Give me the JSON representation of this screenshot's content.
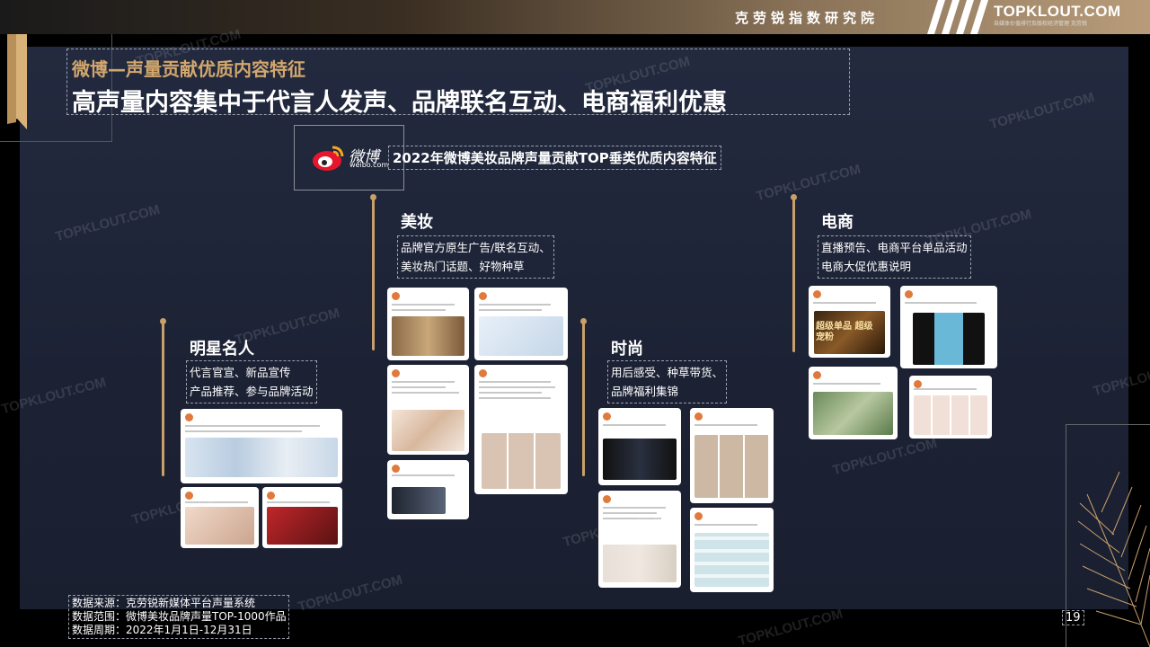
{
  "header": {
    "org_name": "克劳锐指数研究院",
    "brand": "TOPKLOUT.COM",
    "brand_sub": "自媒体价值排行及版权经济管理 克劳锐"
  },
  "slide": {
    "subtitle": "微博—声量贡献优质内容特征",
    "title": "高声量内容集中于代言人发声、品牌联名互动、电商福利优惠",
    "weibo_logo_text": "微博",
    "weibo_url": "weibo.com",
    "chart_title": "2022年微博美妆品牌声量贡献TOP垂类优质内容特征"
  },
  "categories": [
    {
      "name": "明星名人",
      "desc": [
        "代言官宣、新品宣传",
        "产品推荐、参与品牌活动"
      ]
    },
    {
      "name": "美妆",
      "desc": [
        "品牌官方原生广告/联名互动、",
        "美妆热门话题、好物种草"
      ]
    },
    {
      "name": "时尚",
      "desc": [
        "用后感受、种草带货、",
        "品牌福利集锦"
      ]
    },
    {
      "name": "电商",
      "desc": [
        "直播预告、电商平台单品活动",
        "电商大促优惠说明"
      ]
    }
  ],
  "cards": {
    "ecom_1_overlay": "超级单品 超级宠粉"
  },
  "footer": {
    "source_lines": [
      "数据来源：克劳锐新媒体平台声量系统",
      "数据范围：微博美妆品牌声量TOP-1000作品",
      "数据周期：2022年1月1日-12月31日"
    ],
    "page_number": "19"
  },
  "watermark": "TOPKLOUT.COM",
  "colors": {
    "accent_gold": "#c9a06a",
    "panel": "#1e2436",
    "weibo_red": "#e6162d"
  }
}
